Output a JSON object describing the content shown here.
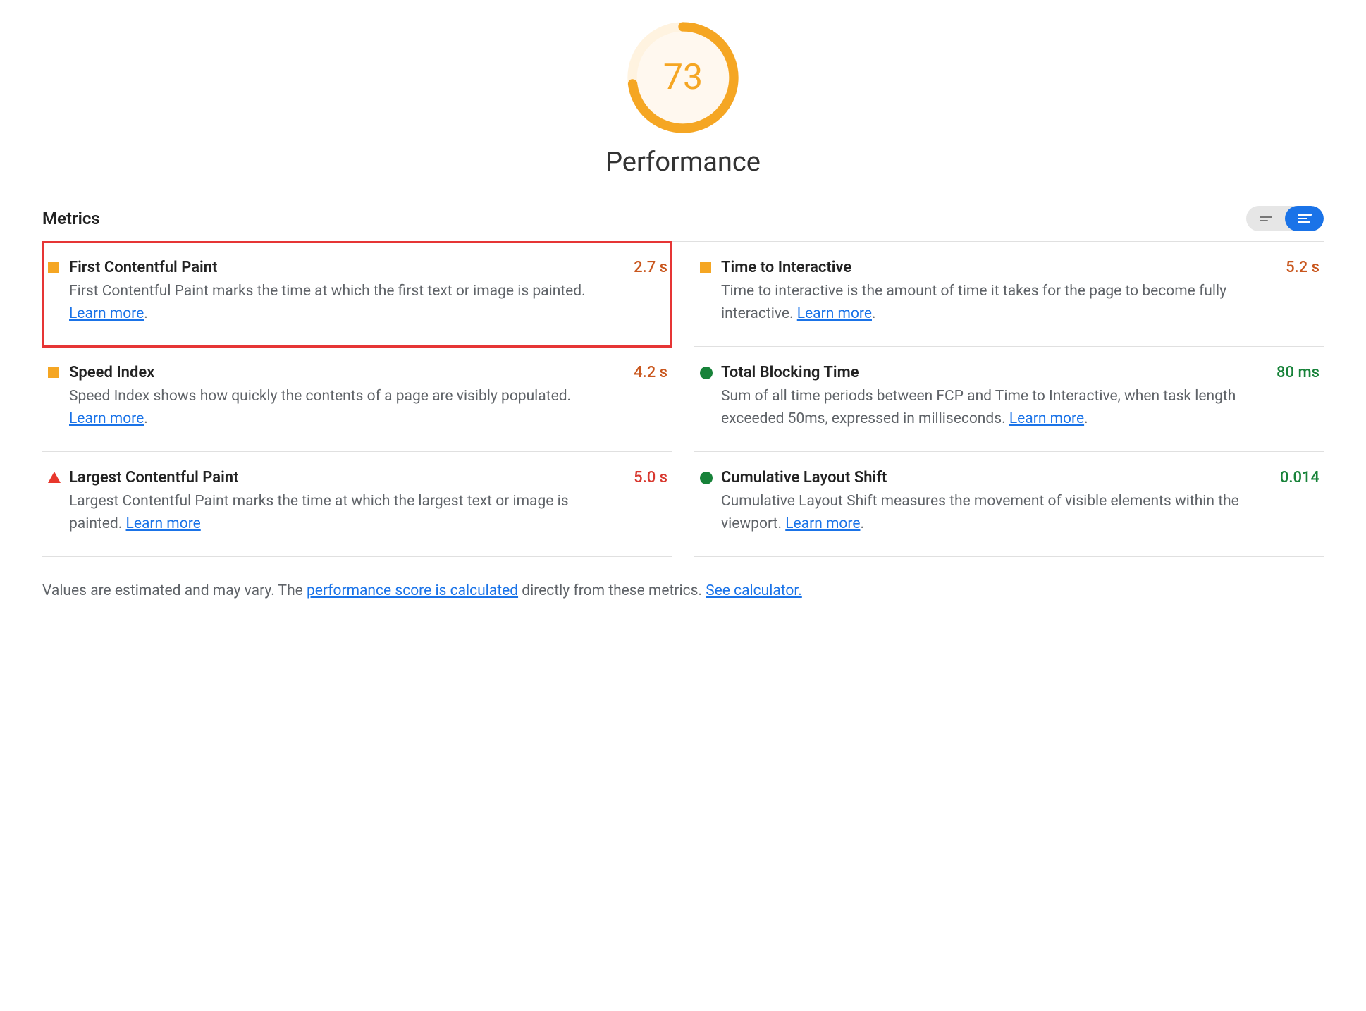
{
  "gauge": {
    "score": "73",
    "percent": 73,
    "title": "Performance",
    "color": "#f5a623"
  },
  "metrics_header": {
    "title": "Metrics"
  },
  "metrics": [
    {
      "id": "fcp",
      "icon": "square",
      "title": "First Contentful Paint",
      "desc_pre": "First Contentful Paint marks the time at which the first text or image is painted. ",
      "learn_more": "Learn more",
      "desc_post": ".",
      "value": "2.7 s",
      "value_class": "val-orange",
      "highlighted": true
    },
    {
      "id": "tti",
      "icon": "square",
      "title": "Time to Interactive",
      "desc_pre": "Time to interactive is the amount of time it takes for the page to become fully interactive. ",
      "learn_more": "Learn more",
      "desc_post": ".",
      "value": "5.2 s",
      "value_class": "val-orange",
      "highlighted": false
    },
    {
      "id": "si",
      "icon": "square",
      "title": "Speed Index",
      "desc_pre": "Speed Index shows how quickly the contents of a page are visibly populated. ",
      "learn_more": "Learn more",
      "desc_post": ".",
      "value": "4.2 s",
      "value_class": "val-orange",
      "highlighted": false
    },
    {
      "id": "tbt",
      "icon": "circle",
      "title": "Total Blocking Time",
      "desc_pre": "Sum of all time periods between FCP and Time to Interactive, when task length exceeded 50ms, expressed in milliseconds. ",
      "learn_more": "Learn more",
      "desc_post": ".",
      "value": "80 ms",
      "value_class": "val-green",
      "highlighted": false
    },
    {
      "id": "lcp",
      "icon": "triangle",
      "title": "Largest Contentful Paint",
      "desc_pre": "Largest Contentful Paint marks the time at which the largest text or image is painted. ",
      "learn_more": "Learn more",
      "desc_post": "",
      "value": "5.0 s",
      "value_class": "val-red",
      "highlighted": false
    },
    {
      "id": "cls",
      "icon": "circle",
      "title": "Cumulative Layout Shift",
      "desc_pre": "Cumulative Layout Shift measures the movement of visible elements within the viewport. ",
      "learn_more": "Learn more",
      "desc_post": ".",
      "value": "0.014",
      "value_class": "val-green",
      "highlighted": false
    }
  ],
  "footer": {
    "pre": "Values are estimated and may vary. The ",
    "link1": "performance score is calculated",
    "mid": " directly from these metrics. ",
    "link2": "See calculator."
  }
}
